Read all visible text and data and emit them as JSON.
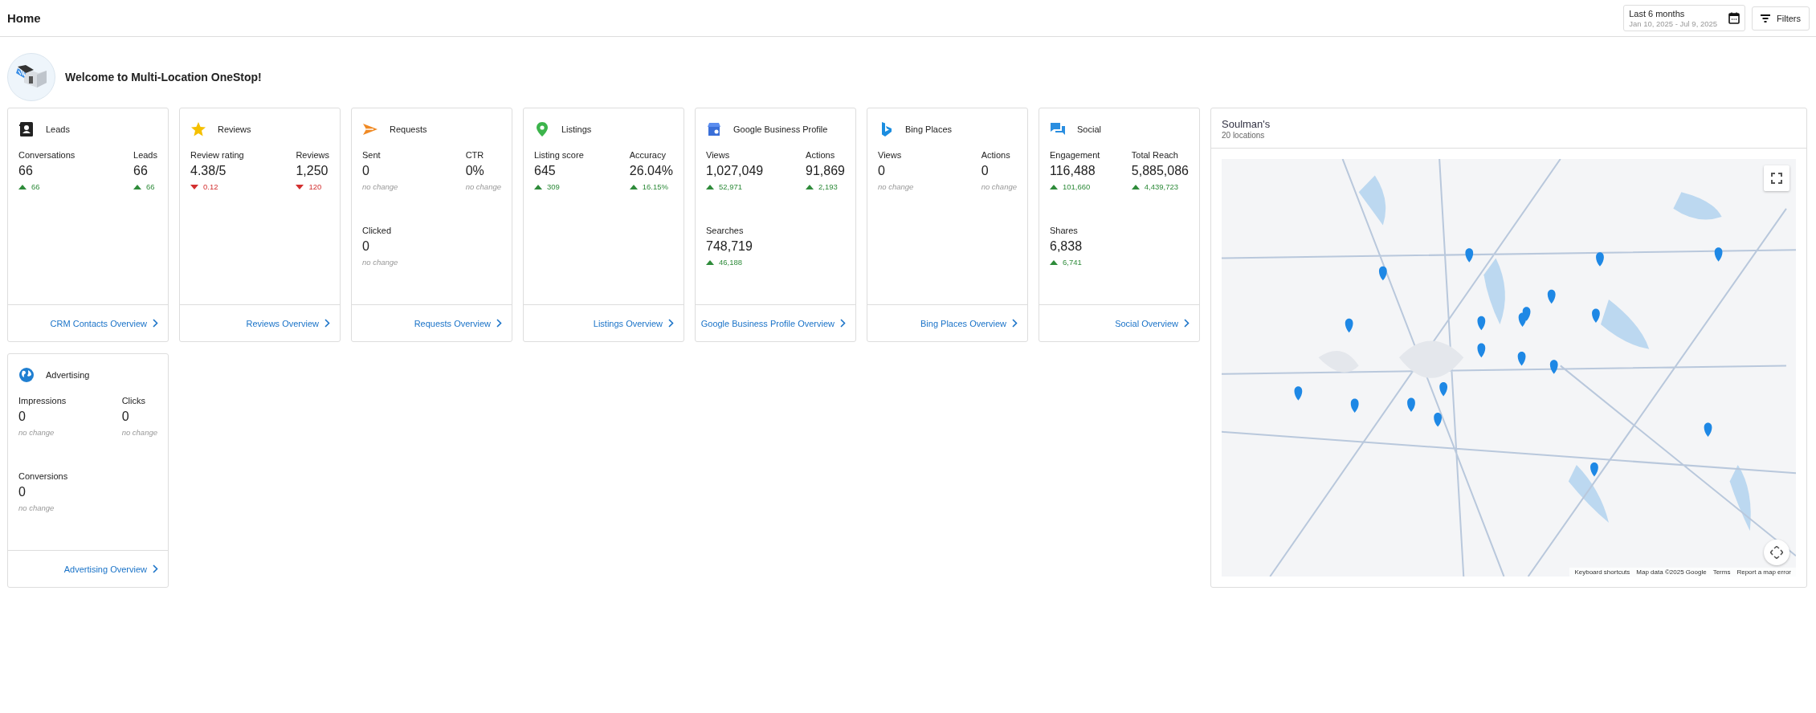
{
  "header": {
    "title": "Home",
    "date_range": {
      "label": "Last 6 months",
      "range": "Jan 10, 2025 - Jul 9, 2025"
    },
    "filters_button": "Filters"
  },
  "welcome": "Welcome to Multi-Location OneStop!",
  "cards": [
    {
      "kind": "leads",
      "title": "Leads",
      "metrics": [
        {
          "label": "Conversations",
          "value": "66",
          "change": "66",
          "kind": "up"
        },
        {
          "label": "Leads",
          "value": "66",
          "change": "66",
          "kind": "up"
        }
      ],
      "link": "CRM Contacts Overview"
    },
    {
      "kind": "reviews",
      "title": "Reviews",
      "metrics": [
        {
          "label": "Review rating",
          "value": "4.38/5",
          "change": "0.12",
          "kind": "down"
        },
        {
          "label": "Reviews",
          "value": "1,250",
          "change": "120",
          "kind": "down"
        }
      ],
      "link": "Reviews Overview"
    },
    {
      "kind": "requests",
      "title": "Requests",
      "metrics": [
        {
          "label": "Sent",
          "value": "0",
          "change": "no change",
          "kind": "flat"
        },
        {
          "label": "CTR",
          "value": "0%",
          "change": "no change",
          "kind": "flat"
        },
        {
          "label": "Clicked",
          "value": "0",
          "change": "no change",
          "kind": "flat"
        }
      ],
      "link": "Requests Overview"
    },
    {
      "kind": "listings",
      "title": "Listings",
      "metrics": [
        {
          "label": "Listing score",
          "value": "645",
          "change": "309",
          "kind": "up"
        },
        {
          "label": "Accuracy",
          "value": "26.04%",
          "change": "16.15%",
          "kind": "up"
        }
      ],
      "link": "Listings Overview"
    },
    {
      "kind": "gbp",
      "title": "Google Business Profile",
      "metrics": [
        {
          "label": "Views",
          "value": "1,027,049",
          "change": "52,971",
          "kind": "up"
        },
        {
          "label": "Actions",
          "value": "91,869",
          "change": "2,193",
          "kind": "up"
        },
        {
          "label": "Searches",
          "value": "748,719",
          "change": "46,188",
          "kind": "up"
        }
      ],
      "link": "Google Business Profile Overview"
    },
    {
      "kind": "bing",
      "title": "Bing Places",
      "metrics": [
        {
          "label": "Views",
          "value": "0",
          "change": "no change",
          "kind": "flat"
        },
        {
          "label": "Actions",
          "value": "0",
          "change": "no change",
          "kind": "flat"
        }
      ],
      "link": "Bing Places Overview"
    },
    {
      "kind": "social",
      "title": "Social",
      "metrics": [
        {
          "label": "Engagement",
          "value": "116,488",
          "change": "101,660",
          "kind": "up"
        },
        {
          "label": "Total Reach",
          "value": "5,885,086",
          "change": "4,439,723",
          "kind": "up"
        },
        {
          "label": "Shares",
          "value": "6,838",
          "change": "6,741",
          "kind": "up"
        }
      ],
      "link": "Social Overview"
    },
    {
      "kind": "advertising",
      "title": "Advertising",
      "metrics": [
        {
          "label": "Impressions",
          "value": "0",
          "change": "no change",
          "kind": "flat"
        },
        {
          "label": "Clicks",
          "value": "0",
          "change": "no change",
          "kind": "flat"
        },
        {
          "label": "Conversions",
          "value": "0",
          "change": "no change",
          "kind": "flat"
        }
      ],
      "link": "Advertising Overview"
    }
  ],
  "map_card": {
    "title": "Soulman's",
    "subtitle": "20 locations",
    "attribution": [
      "Keyboard shortcuts",
      "Map data ©2025 Google",
      "Terms",
      "Report a map error"
    ]
  }
}
